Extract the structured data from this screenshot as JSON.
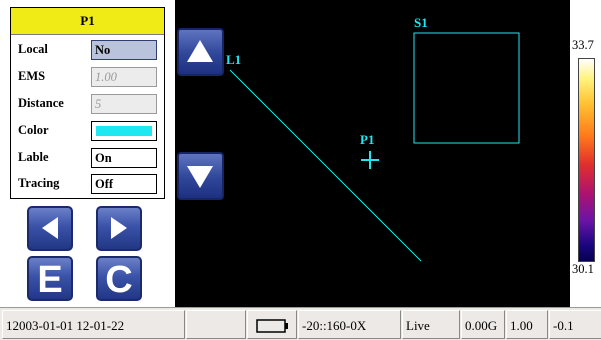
{
  "properties": {
    "title": "P1",
    "rows": [
      {
        "label": "Local",
        "value": "No"
      },
      {
        "label": "EMS",
        "value": "1.00"
      },
      {
        "label": "Distance",
        "value": "5"
      },
      {
        "label": "Color",
        "value": ""
      },
      {
        "label": "Lable",
        "value": "On"
      },
      {
        "label": "Tracing",
        "value": "Off"
      }
    ],
    "color_value_hex": "#1fe8f2"
  },
  "nav_buttons": {
    "left_icon": "arrow-left-icon",
    "right_icon": "arrow-right-icon",
    "e_label": "E",
    "c_label": "C"
  },
  "viewport": {
    "scroll_up_icon": "arrow-up-icon",
    "scroll_down_icon": "arrow-down-icon",
    "line_label_partial": "L1",
    "area_label": "S1",
    "point_label": "P1",
    "overlay_color": "#1fe8f2"
  },
  "palette": {
    "max": "33.7",
    "min": "30.1"
  },
  "status": {
    "datetime": "12003-01-01 12-01-22",
    "empty_cell": "",
    "battery_icon": "battery-icon",
    "range": "-20::160-0X",
    "mode": "Live",
    "storage": "0.00G",
    "emissivity": "1.00",
    "extra": "-0.1"
  }
}
